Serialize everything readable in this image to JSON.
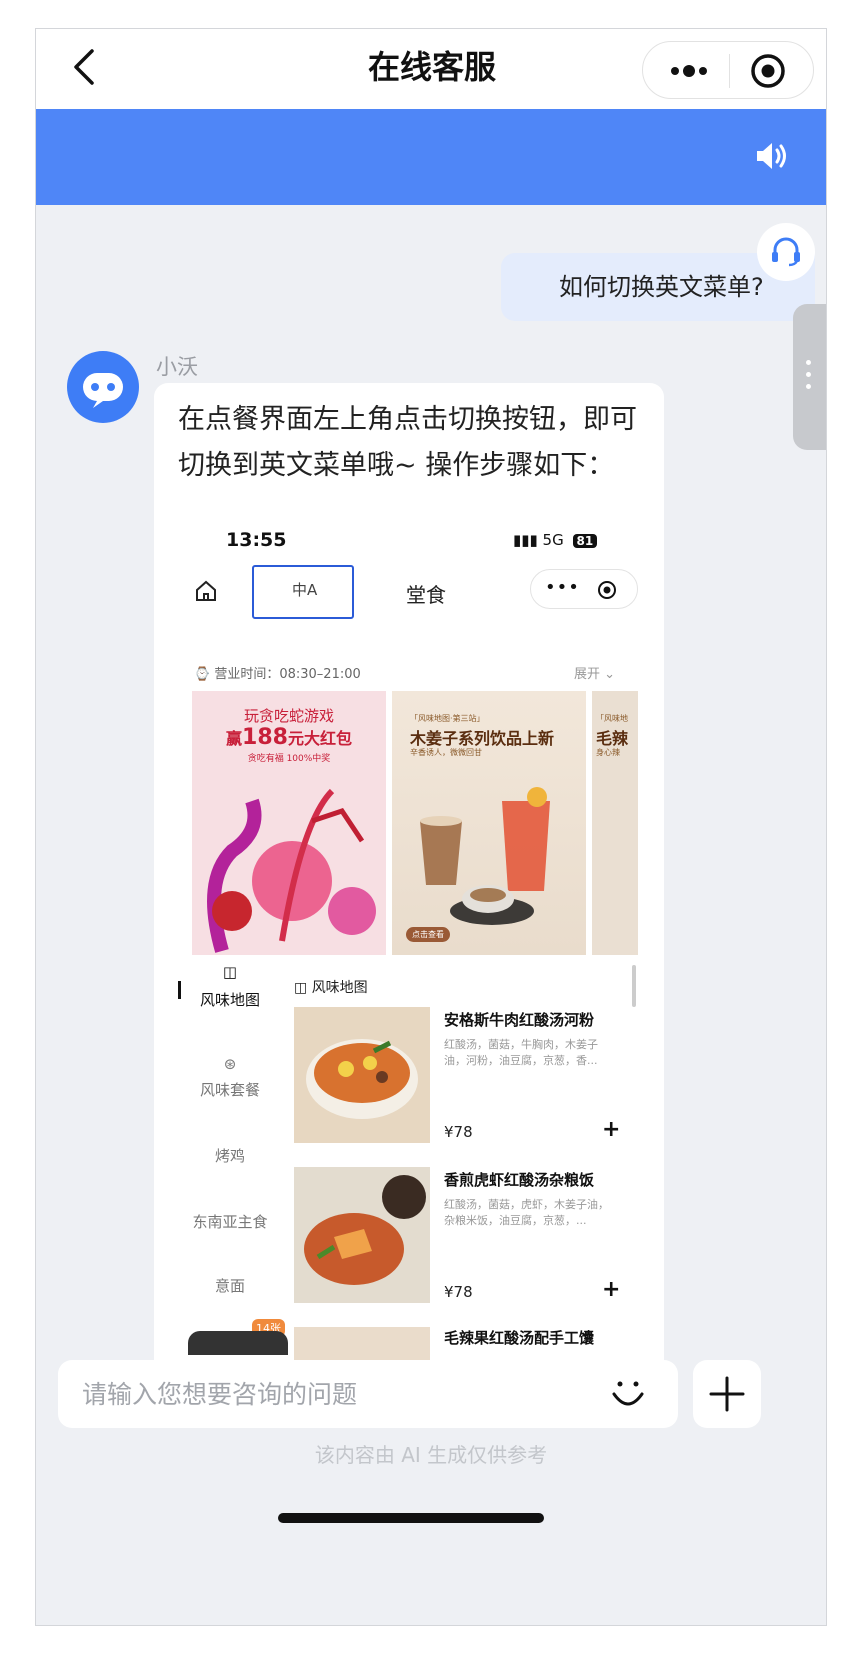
{
  "nav": {
    "title": "在线客服",
    "more_icon": "ellipsis-icon",
    "close_icon": "target-circle-icon",
    "back_icon": "chevron-left-icon"
  },
  "band": {
    "color": "#4f86f7",
    "icon": "speaker-icon"
  },
  "chat": {
    "user_message": "如何切换英文菜单?",
    "agent_icon": "headset-icon",
    "bot_name": "小沃",
    "bot_message": "在点餐界面左上角点击切换按钮，即可切换到英文菜单哦~ 操作步骤如下：",
    "screenshot": {
      "time": "13:55",
      "network": "5G",
      "battery": "81",
      "lang_icon": "中A",
      "dine_label": "堂食",
      "hours_label": "营业时间：",
      "hours_value": "08:30–21:00",
      "expand_label": "展开",
      "banners": [
        {
          "line1": "玩贪吃蛇游戏",
          "line2_prefix": "赢",
          "line2_amount": "188",
          "line2_suffix": "元大红包",
          "line3": "贪吃有福 100%中奖"
        },
        {
          "tag": "「风味地图·第三站」",
          "title": "木姜子系列饮品上新",
          "sub": "辛香诱人，微微回甘",
          "button": "点击查看"
        },
        {
          "tag": "「风味地",
          "title": "毛辣",
          "sub": "身心辣"
        }
      ],
      "categories": [
        {
          "label": "风味地图",
          "active": true
        },
        {
          "label": "风味套餐",
          "active": false
        },
        {
          "label": "烤鸡",
          "active": false
        },
        {
          "label": "东南亚主食",
          "active": false
        },
        {
          "label": "意面",
          "active": false
        }
      ],
      "section_title": "风味地图",
      "dishes": [
        {
          "name": "安格斯牛肉红酸汤河粉",
          "desc": "红酸汤，菌菇，牛胸肉，木姜子油，河粉，油豆腐，京葱，香...",
          "price": "¥78"
        },
        {
          "name": "香煎虎虾红酸汤杂粮饭",
          "desc": "红酸汤，菌菇，虎虾，木姜子油，杂粮米饭，油豆腐，京葱，...",
          "price": "¥78"
        },
        {
          "name": "毛辣果红酸汤配手工馕",
          "desc": "",
          "price": ""
        }
      ],
      "photo_badge": "14张"
    }
  },
  "input": {
    "placeholder": "请输入您想要咨询的问题",
    "emoji_icon": "smiley-icon",
    "plus_icon": "plus-icon"
  },
  "disclaimer": "该内容由 AI 生成仅供参考"
}
